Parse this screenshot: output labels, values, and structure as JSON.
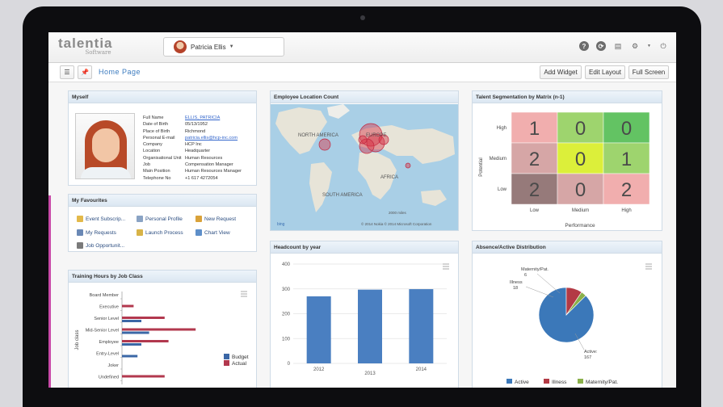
{
  "app": {
    "logo": "talentia",
    "logo_sub": "Software"
  },
  "user": {
    "name": "Patricia Ellis"
  },
  "nav": {
    "breadcrumb": "Home Page",
    "add_widget": "Add Widget",
    "edit_layout": "Edit Layout",
    "full_screen": "Full Screen"
  },
  "myself": {
    "title": "Myself",
    "fields": [
      {
        "label": "Full Name",
        "value": "ELLIS, PATRICIA"
      },
      {
        "label": "Date of Birth",
        "value": "05/13/1952"
      },
      {
        "label": "Place of Birth",
        "value": "Richmond"
      },
      {
        "label": "Personal E-mail",
        "value": "patricia.ellis@hcp-inc.com"
      },
      {
        "label": "Company",
        "value": "HCP Inc"
      },
      {
        "label": "Location",
        "value": "Headquarter"
      },
      {
        "label": "Organisational Unit",
        "value": "Human Resources"
      },
      {
        "label": "Job",
        "value": "Compensation Manager"
      },
      {
        "label": "Main Position",
        "value": "Human Resources Manager"
      },
      {
        "label": "Telephone No",
        "value": "+1 617 4272054"
      }
    ]
  },
  "favourites": {
    "title": "My Favourites",
    "items": [
      "Event Subscrip...",
      "Personal Profile",
      "New Request",
      "My Requests",
      "Launch Process",
      "Chart View",
      "Job Opportunit..."
    ]
  },
  "location": {
    "title": "Employee Location Count",
    "labels": [
      "NORTH AMERICA",
      "EUROPE",
      "AFRICA",
      "SOUTH AMERICA"
    ],
    "bing": "bing",
    "scale": "2000 miles",
    "copyright": "© 2014 Nokia  © 2014 Microsoft Corporation"
  },
  "segmentation": {
    "title": "Talent Segmentation by Matrix (n-1)",
    "ylabel": "Potential",
    "xlabel": "Performance",
    "rows": [
      "High",
      "Medium",
      "Low"
    ],
    "cols": [
      "Low",
      "Medium",
      "High"
    ],
    "values": [
      [
        1,
        0,
        0
      ],
      [
        2,
        0,
        1
      ],
      [
        2,
        0,
        2
      ]
    ],
    "colors": [
      [
        "#f1aeae",
        "#9ed46e",
        "#63c363"
      ],
      [
        "#d6a6a6",
        "#dcef3a",
        "#9ed46e"
      ],
      [
        "#967a7a",
        "#d6a6a6",
        "#f1aeae"
      ]
    ]
  },
  "headcount": {
    "title": "Headcount by year"
  },
  "training": {
    "title": "Training Hours by Job Class",
    "ylabel": "Job class",
    "legend": [
      "Budget",
      "Actual"
    ]
  },
  "absence": {
    "title": "Absence/Active Distribution"
  },
  "chart_data": [
    {
      "type": "bar",
      "title": "Headcount by year",
      "categories": [
        "2012",
        "2013",
        "2014"
      ],
      "values": [
        270,
        297,
        299
      ],
      "ylim": [
        0,
        400
      ],
      "yticks": [
        0,
        100,
        200,
        300,
        400
      ],
      "color": "#4a7fc1"
    },
    {
      "type": "bar",
      "orientation": "horizontal",
      "title": "Training Hours by Job Class",
      "ylabel": "Job class",
      "categories": [
        "Board Member",
        "Executive",
        "Senior Level",
        "Mid-Senior Level",
        "Employee",
        "Entry-Level",
        "Joker",
        "Undefined"
      ],
      "series": [
        {
          "name": "Budget",
          "color": "#3b67a6",
          "values": [
            0,
            0,
            10,
            14,
            10,
            8,
            0,
            0
          ]
        },
        {
          "name": "Actual",
          "color": "#b2384e",
          "values": [
            0,
            6,
            22,
            38,
            24,
            0,
            0,
            22
          ]
        }
      ]
    },
    {
      "type": "pie",
      "title": "Absence/Active Distribution",
      "series": [
        {
          "name": "Active",
          "value": 167,
          "color": "#3b78b9"
        },
        {
          "name": "Illness",
          "value": 18,
          "color": "#b33a45"
        },
        {
          "name": "Maternity/Pat.",
          "value": 6,
          "color": "#8ab04a"
        }
      ]
    }
  ]
}
